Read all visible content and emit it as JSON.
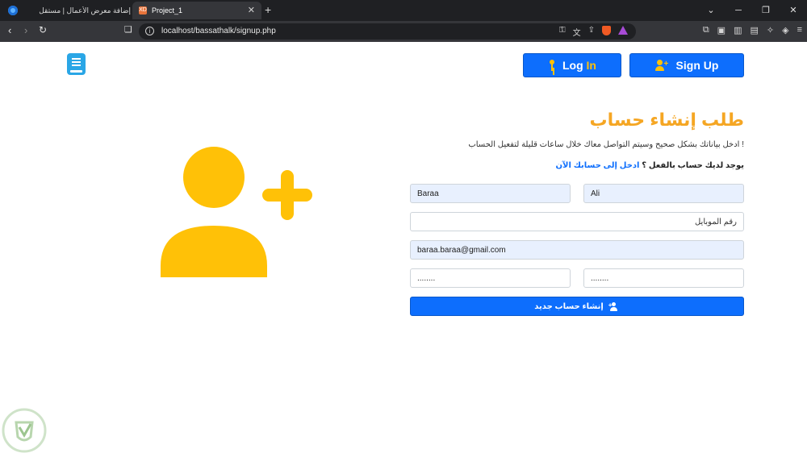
{
  "browser": {
    "tabs": [
      {
        "title": "إضافة معرض الأعمال | مستقل"
      },
      {
        "title": "Project_1",
        "favicon": "XD"
      }
    ],
    "url": "localhost/bassathalk/signup.php"
  },
  "header": {
    "login_word": "Log",
    "login_word_accent": "In",
    "signup_label": "Sign Up"
  },
  "form": {
    "title": "طلب إنشاء حساب",
    "subtitle": "! ادخل بياناتك بشكل صحيح وسيتم التواصل معاك خلال ساعات قليلة لتفعيل الحساب",
    "have_account_text": "يوجد لديك حساب بالفعل ؟",
    "login_link": "ادخل إلى حسابك الآن",
    "first_name": "Baraa",
    "last_name": "Ali",
    "mobile_placeholder": "رقم الموبايل",
    "email": "baraa.baraa@gmail.com",
    "password": "........",
    "confirm_password": "........",
    "submit_label": "إنشاء حساب جديد"
  },
  "colors": {
    "primary": "#0d6efd",
    "accent": "#ffc107",
    "title": "#f5a623"
  },
  "icons": [
    "key-icon",
    "user-plus-icon",
    "book-logo-icon"
  ]
}
